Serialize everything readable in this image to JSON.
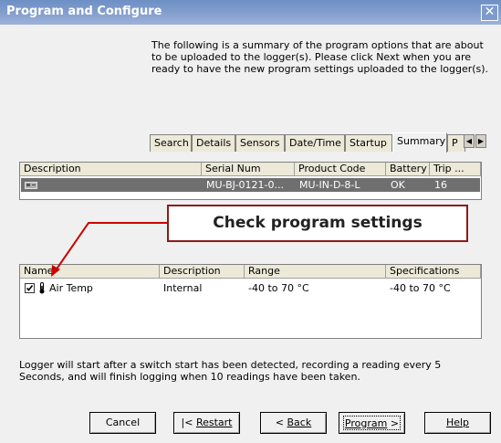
{
  "window": {
    "title": "Program and Configure",
    "close_label": "✕"
  },
  "intro": "The following is a summary of the program options that are about to be uploaded to the logger(s). Please click Next when you are ready to have the new program settings uploaded to the logger(s).",
  "tabs": [
    "Search",
    "Details",
    "Sensors",
    "Date/Time",
    "Startup",
    "Summary",
    "P"
  ],
  "active_tab": "Summary",
  "logger_table": {
    "headers": [
      "Description",
      "Serial Num",
      "Product Code",
      "Battery",
      "Trip ..."
    ],
    "rows": [
      {
        "icon": "logger-icon",
        "description": "",
        "serial": "MU-BJ-0121-0...",
        "product_code": "MU-IN-D-8-L",
        "battery": "OK",
        "trip": "16"
      }
    ]
  },
  "callout": "Check program settings",
  "sensor_table": {
    "headers": [
      "Name",
      "Description",
      "Range",
      "Specifications"
    ],
    "rows": [
      {
        "checked": true,
        "icon": "thermometer-icon",
        "name": "Air Temp",
        "description": "Internal",
        "range": "-40 to 70 °C",
        "specifications": "-40 to 70 °C"
      }
    ]
  },
  "summary": "Logger will start after a switch start has been detected, recording a reading every 5 Seconds, and will finish logging when 10 readings have been taken.",
  "buttons": {
    "cancel": "Cancel",
    "restart": "Restart",
    "restart_prefix": "|< ",
    "back": "Back",
    "back_prefix": "< ",
    "program": "Program",
    "program_suffix": " >",
    "help": "Help"
  },
  "colors": {
    "titlebar": "#7e9acb",
    "callout_border": "#8b1a1a",
    "arrow": "#cc0000",
    "selection": "#6f6f6f"
  }
}
